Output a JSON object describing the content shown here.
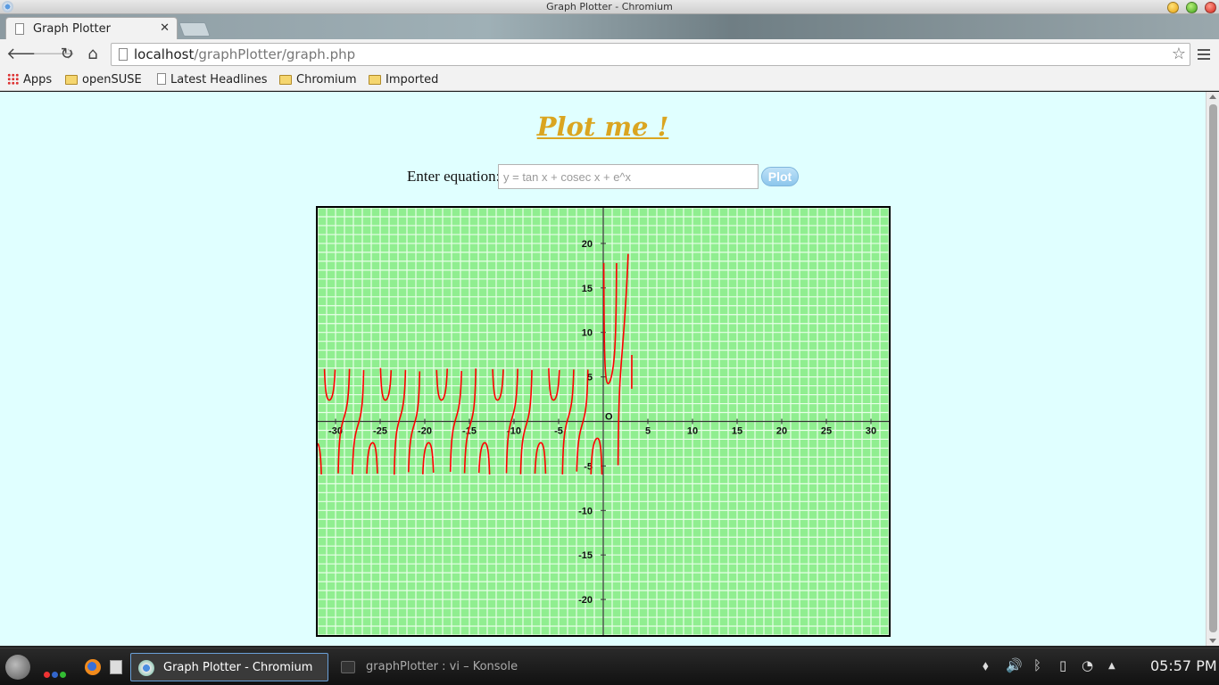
{
  "window": {
    "title": "Graph Plotter - Chromium"
  },
  "tabs": [
    {
      "label": "Graph Plotter"
    }
  ],
  "toolbar": {
    "url_host": "localhost",
    "url_path": "/graphPlotter/graph.php"
  },
  "bookmarks": [
    {
      "label": "Apps",
      "icon": "apps-icon"
    },
    {
      "label": "openSUSE",
      "icon": "folder-icon"
    },
    {
      "label": "Latest Headlines",
      "icon": "page-icon"
    },
    {
      "label": "Chromium",
      "icon": "folder-icon"
    },
    {
      "label": "Imported",
      "icon": "folder-icon"
    }
  ],
  "page": {
    "title": "Plot me !",
    "title_color": "#daa520",
    "background_color": "#e0ffff",
    "equation_label": "Enter equation:",
    "equation_placeholder": "y = tan x + cosec x + e^x",
    "plot_button": "Plot"
  },
  "chart_data": {
    "type": "line",
    "title": "",
    "origin_label": "O",
    "xlim": [
      -32,
      32
    ],
    "ylim": [
      -24,
      24
    ],
    "x_ticks": [
      -30,
      -25,
      -20,
      -15,
      -10,
      -5,
      5,
      10,
      15,
      20,
      25,
      30
    ],
    "y_ticks": [
      -20,
      -15,
      -10,
      -5,
      5,
      10,
      15,
      20
    ],
    "grid": true,
    "background_color": "#90ee90",
    "grid_color": "#e8ffe8",
    "curve_color": "#ff0000",
    "y_clip": [
      -6,
      6
    ],
    "exp_clip_max": 19,
    "series": [
      {
        "expression": "y = tan x + cosec x + e^x"
      }
    ]
  },
  "taskbar": {
    "tasks": [
      {
        "label": "Graph Plotter - Chromium",
        "active": true
      },
      {
        "label": "graphPlotter : vi – Konsole",
        "active": false
      }
    ],
    "clock": "05:57 PM"
  }
}
